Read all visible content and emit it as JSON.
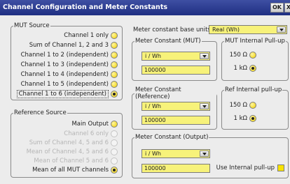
{
  "window": {
    "title": "Channel Configuration and Meter Constants",
    "ok_label": "OK",
    "close_label": "X"
  },
  "mut_source": {
    "legend": "MUT Source",
    "options": [
      {
        "label": "Channel 1 only",
        "selected": false
      },
      {
        "label": "Sum of Channel 1, 2 and 3",
        "selected": false
      },
      {
        "label": "Channel 1 to 2 (independent)",
        "selected": false
      },
      {
        "label": "Channel 1 to 3 (independent)",
        "selected": false
      },
      {
        "label": "Channel 1 to 4 (independent)",
        "selected": false
      },
      {
        "label": "Channel 1 to 5 (independent)",
        "selected": false
      },
      {
        "label": "Channel 1 to 6 (independent)",
        "selected": true
      }
    ]
  },
  "reference_source": {
    "legend": "Reference Source",
    "options": [
      {
        "label": "Main Output",
        "selected": false,
        "enabled": true
      },
      {
        "label": "Channel 6 only",
        "selected": false,
        "enabled": false
      },
      {
        "label": "Sum of Channel 4, 5 and 6",
        "selected": false,
        "enabled": false
      },
      {
        "label": "Mean of Channel 4, 5 and 6",
        "selected": false,
        "enabled": false
      },
      {
        "label": "Mean of Channel 5 and 6",
        "selected": false,
        "enabled": false
      },
      {
        "label": "Mean of all MUT channels",
        "selected": true,
        "enabled": true
      }
    ]
  },
  "base_units": {
    "label": "Meter constant base units",
    "value": "Real (Wh)"
  },
  "meter_mut": {
    "legend": "Meter Constant (MUT)",
    "unit": "i / Wh",
    "value": "100000"
  },
  "mut_pullup": {
    "legend": "MUT Internal Pull-up",
    "opt1": "150 Ω",
    "opt2": "1 kΩ",
    "selected": "1 kΩ"
  },
  "meter_ref": {
    "legend": "Meter Constant (Reference)",
    "unit": "i / Wh",
    "value": "100000"
  },
  "ref_pullup": {
    "legend": "Ref Internal pull-up",
    "opt1": "150 Ω",
    "opt2": "1 kΩ",
    "selected": "1 kΩ"
  },
  "meter_out": {
    "legend": "Meter Constant (Output)",
    "unit": "i / Wh",
    "value": "100000",
    "pullup_label": "Use Internal pull-up"
  },
  "colors": {
    "accent": "#f7f27a",
    "title": "#1f2f82"
  }
}
